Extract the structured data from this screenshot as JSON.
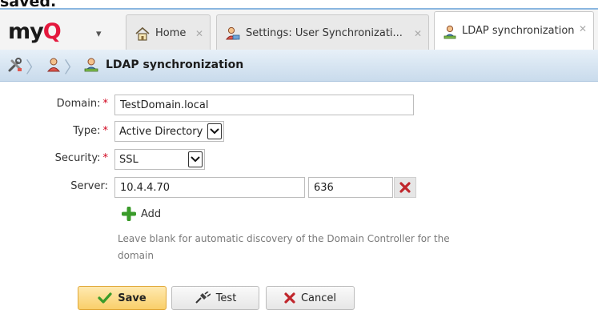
{
  "caption": "saved.",
  "app": {
    "logo_text": "my",
    "logo_accent": "Q",
    "logo_accent_color": "#e4183d"
  },
  "tabs": [
    {
      "label": "Home",
      "icon": "home-icon",
      "active": false
    },
    {
      "label": "Settings: User Synchronizati...",
      "icon": "users-icon",
      "active": false
    },
    {
      "label": "LDAP synchronization",
      "icon": "ldap-user-icon",
      "active": true
    }
  ],
  "breadcrumb": {
    "icons": [
      "tools-icon",
      "users-icon",
      "ldap-user-icon"
    ],
    "title": "LDAP synchronization"
  },
  "form": {
    "domain": {
      "label": "Domain:",
      "required": "*",
      "value": "TestDomain.local"
    },
    "type": {
      "label": "Type:",
      "required": "*",
      "value": "Active Directory"
    },
    "security": {
      "label": "Security:",
      "required": "*",
      "value": "SSL"
    },
    "server": {
      "label": "Server:",
      "host": "10.4.4.70",
      "port": "636"
    },
    "add_label": "Add",
    "hint": "Leave blank for automatic discovery of the Domain Controller for the domain"
  },
  "buttons": {
    "save": "Save",
    "test": "Test",
    "cancel": "Cancel"
  }
}
